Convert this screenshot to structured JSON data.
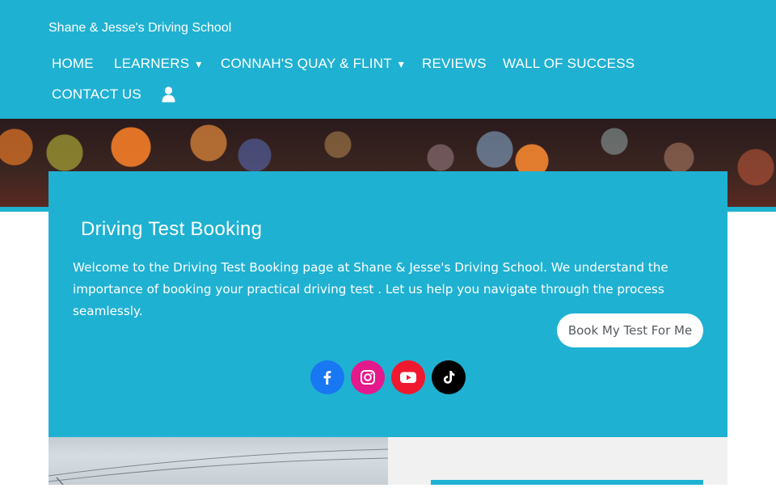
{
  "header": {
    "site_title": "Shane & Jesse's Driving School",
    "nav": [
      {
        "label": "HOME"
      },
      {
        "label": "LEARNERS",
        "caret": "▾"
      },
      {
        "label": "CONNAH'S QUAY & FLINT",
        "caret": "▾"
      },
      {
        "label": "REVIEWS"
      },
      {
        "label": "WALL OF SUCCESS"
      },
      {
        "label": "CONTACT US"
      }
    ],
    "account_icon": "user-icon"
  },
  "main": {
    "title": "Driving Test Booking",
    "intro": "Welcome to the Driving Test Booking page at Shane & Jesse's Driving School. We understand the importance of booking your practical driving test . Let us help you navigate through the process seamlessly.",
    "cta_label": "Book My Test For Me",
    "social": [
      {
        "icon": "facebook-icon",
        "color": "#1877f2"
      },
      {
        "icon": "instagram-icon",
        "color": "#e4198c"
      },
      {
        "icon": "youtube-icon",
        "color": "#f0182e"
      },
      {
        "icon": "tiktok-icon",
        "color": "#000000"
      }
    ]
  },
  "colors": {
    "accent": "#1fb1d2",
    "white": "#ffffff",
    "button_text": "#555b5e"
  }
}
